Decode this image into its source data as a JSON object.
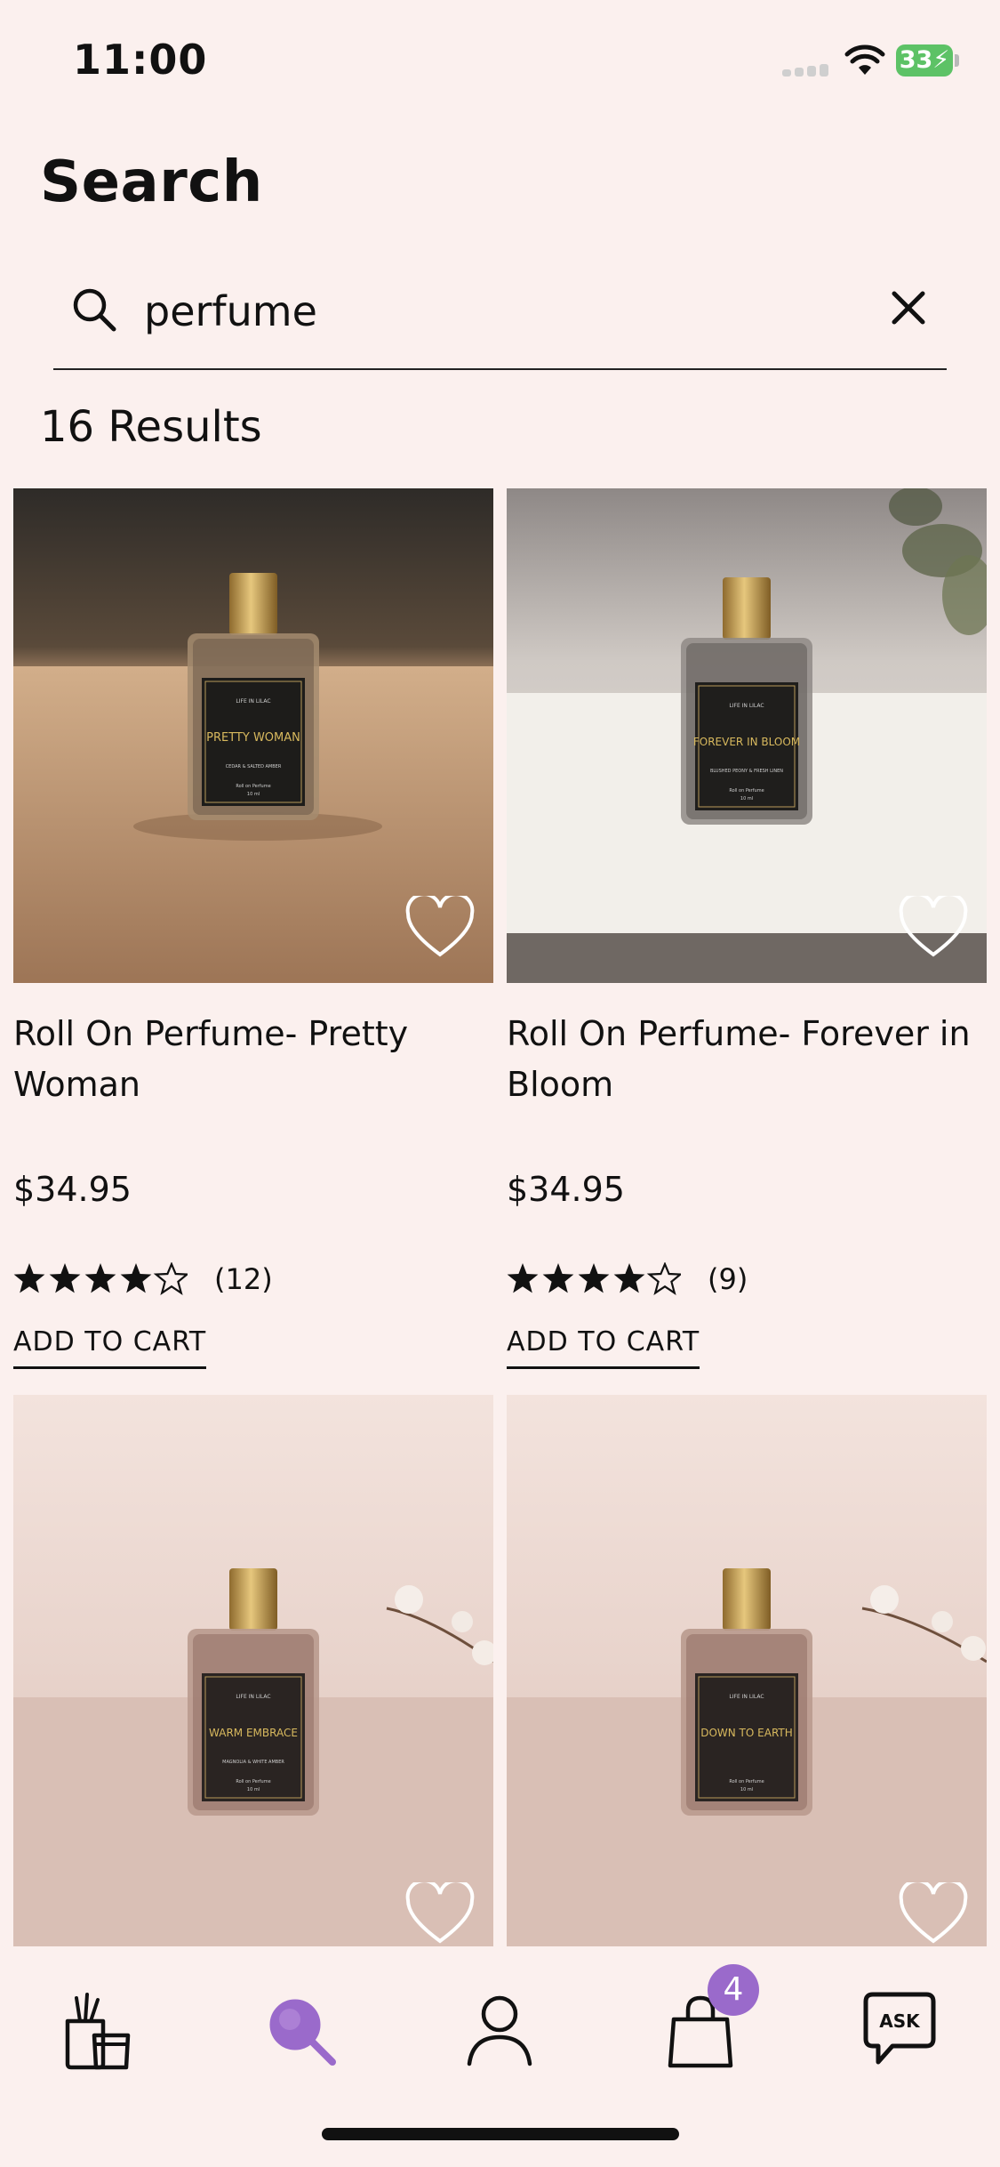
{
  "status_bar": {
    "time": "11:00",
    "battery": "33"
  },
  "header": {
    "title": "Search"
  },
  "search": {
    "value": "perfume",
    "placeholder": ""
  },
  "results": {
    "count_label": "16 Results"
  },
  "products": [
    {
      "title": "Roll On Perfume- Pretty Woman",
      "price": "$34.95",
      "rating": 4.5,
      "review_count": "(12)",
      "add_to_cart": "ADD TO CART",
      "label_name": "PRETTY WOMAN",
      "label_notes": "CEDAR & SALTED AMBER"
    },
    {
      "title": "Roll On Perfume- Forever in Bloom",
      "price": "$34.95",
      "rating": 4.5,
      "review_count": "(9)",
      "add_to_cart": "ADD TO CART",
      "label_name": "FOREVER IN BLOOM",
      "label_notes": "BLUSHED PEONY & FRESH LINEN"
    },
    {
      "label_name": "WARM EMBRACE",
      "label_notes": "MAGNOLIA & WHITE AMBER"
    },
    {
      "label_name": "DOWN TO EARTH"
    }
  ],
  "brand": {
    "name": "LIFE IN LILAC",
    "sub_label": "Roll on Perfume",
    "volume": "10 ml"
  },
  "tab_bar": {
    "items": [
      {
        "id": "shop",
        "icon": "candle-icon"
      },
      {
        "id": "search",
        "icon": "search-icon",
        "active": true
      },
      {
        "id": "account",
        "icon": "person-icon"
      },
      {
        "id": "cart",
        "icon": "bag-icon",
        "badge": "4"
      },
      {
        "id": "ask",
        "icon": "ask-chat-icon",
        "label": "ASK"
      }
    ]
  },
  "colors": {
    "background": "#FBF0EE",
    "accent": "#9A6ACB",
    "text": "#111111"
  }
}
